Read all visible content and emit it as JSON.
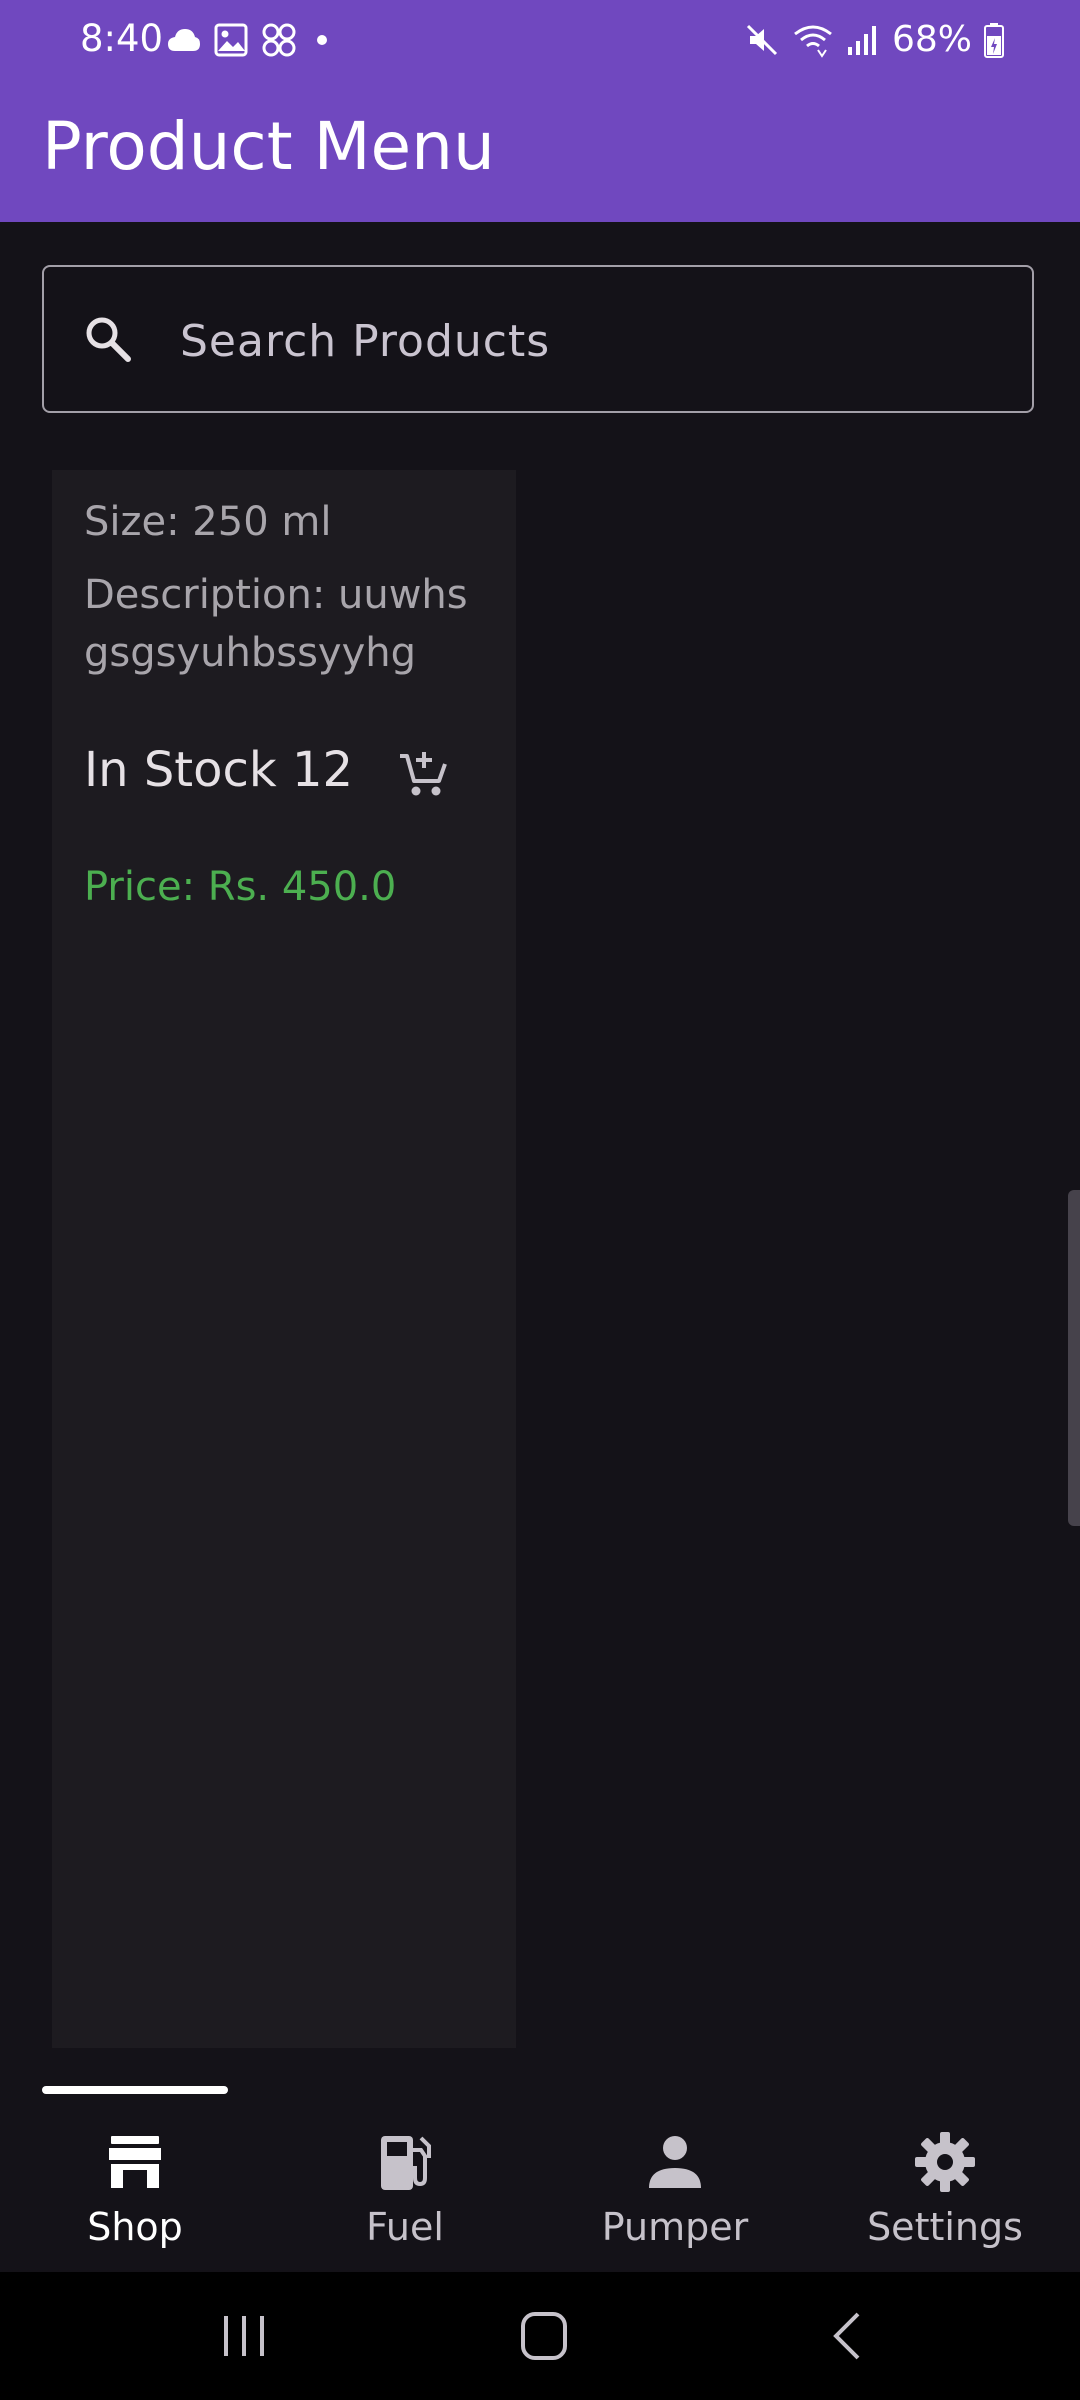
{
  "status_bar": {
    "time": "8:40",
    "battery": "68%",
    "left_icons": [
      "cloud-icon",
      "image-icon",
      "apps-icon",
      "dot-icon"
    ],
    "right_icons": [
      "mute-icon",
      "wifi-icon",
      "signal-icon",
      "battery-icon"
    ]
  },
  "app_bar": {
    "title": "Product Menu",
    "color": "#7048bf"
  },
  "search": {
    "placeholder": "Search Products",
    "value": "",
    "icon": "search-icon"
  },
  "product": {
    "size": "Size: 250 ml",
    "description": "Description: uuwhs gsgsyuhbssyyhg",
    "stock": "In Stock 12",
    "price": "Price: Rs. 450.0",
    "price_color": "#4caf50",
    "cart_icon": "add-shopping-cart-icon"
  },
  "bottom_nav": {
    "active_index": 0,
    "tabs": [
      {
        "label": "Shop",
        "icon": "store-icon"
      },
      {
        "label": "Fuel",
        "icon": "fuel-pump-icon"
      },
      {
        "label": "Pumper",
        "icon": "person-icon"
      },
      {
        "label": "Settings",
        "icon": "gear-icon"
      }
    ]
  },
  "system_nav": {
    "buttons": [
      "recents-icon",
      "home-icon",
      "back-icon"
    ]
  }
}
